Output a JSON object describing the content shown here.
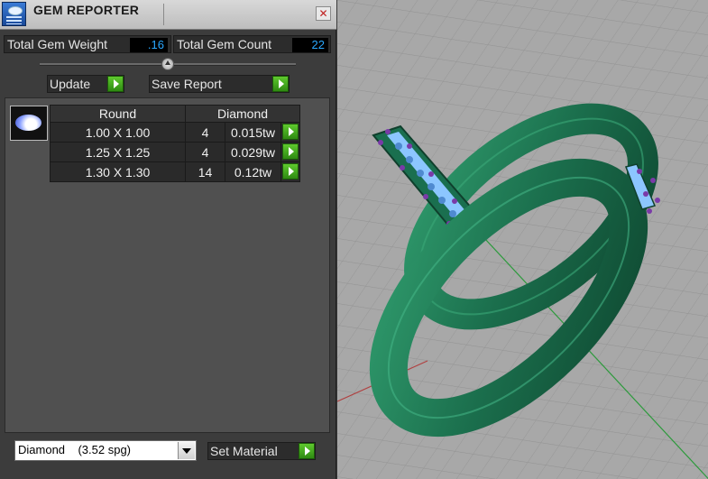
{
  "window": {
    "title": "GEM REPORTER"
  },
  "stats": {
    "weight_label": "Total Gem Weight",
    "weight_value": ".16",
    "count_label": "Total Gem Count",
    "count_value": "22"
  },
  "actions": {
    "update_label": "Update",
    "save_label": "Save Report"
  },
  "table": {
    "headers": [
      "Round",
      "Diamond"
    ],
    "rows": [
      {
        "size": "1.00 X 1.00",
        "count": "4",
        "weight": "0.015tw"
      },
      {
        "size": "1.25 X 1.25",
        "count": "4",
        "weight": "0.029tw"
      },
      {
        "size": "1.30 X 1.30",
        "count": "14",
        "weight": "0.12tw"
      }
    ]
  },
  "material": {
    "selected": "Diamond    (3.52 spg)",
    "set_label": "Set Material"
  },
  "colors": {
    "value_text": "#2aa8ff",
    "arrow_green": "#3aa81c",
    "ring": "#1f7a55",
    "stones": "#7fb4ff",
    "prongs": "#7a3aa8"
  }
}
